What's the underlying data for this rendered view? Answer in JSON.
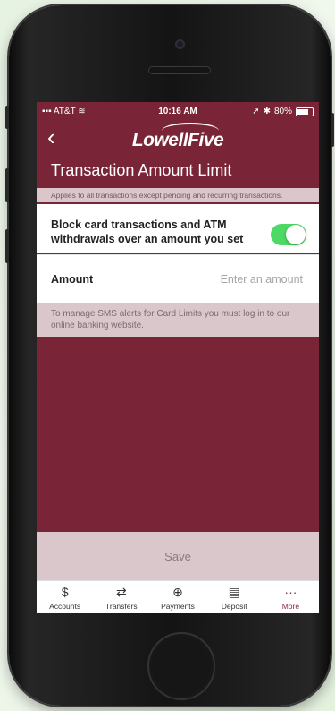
{
  "status_bar": {
    "carrier": "AT&T",
    "time": "10:16 AM",
    "battery": "80%"
  },
  "header": {
    "logo": "LowellFive",
    "title": "Transaction Amount Limit"
  },
  "info": {
    "applies_text": "Applies to all transactions except pending and recurring transactions."
  },
  "block_setting": {
    "label": "Block card transactions and ATM withdrawals over an amount you set",
    "enabled": true
  },
  "amount": {
    "label": "Amount",
    "value": "",
    "placeholder": "Enter an amount"
  },
  "sms_note": "To manage SMS alerts for Card Limits you must log in to our online banking website.",
  "save_label": "Save",
  "tabs": [
    {
      "label": "Accounts",
      "icon": "dollar-icon"
    },
    {
      "label": "Transfers",
      "icon": "transfer-arrows-icon"
    },
    {
      "label": "Payments",
      "icon": "payment-hand-icon"
    },
    {
      "label": "Deposit",
      "icon": "check-deposit-icon"
    },
    {
      "label": "More",
      "icon": "more-dots-icon",
      "active": true
    }
  ],
  "colors": {
    "brand": "#7a2537",
    "toggle_on": "#4cd964",
    "info_band": "#d9c7cc"
  }
}
